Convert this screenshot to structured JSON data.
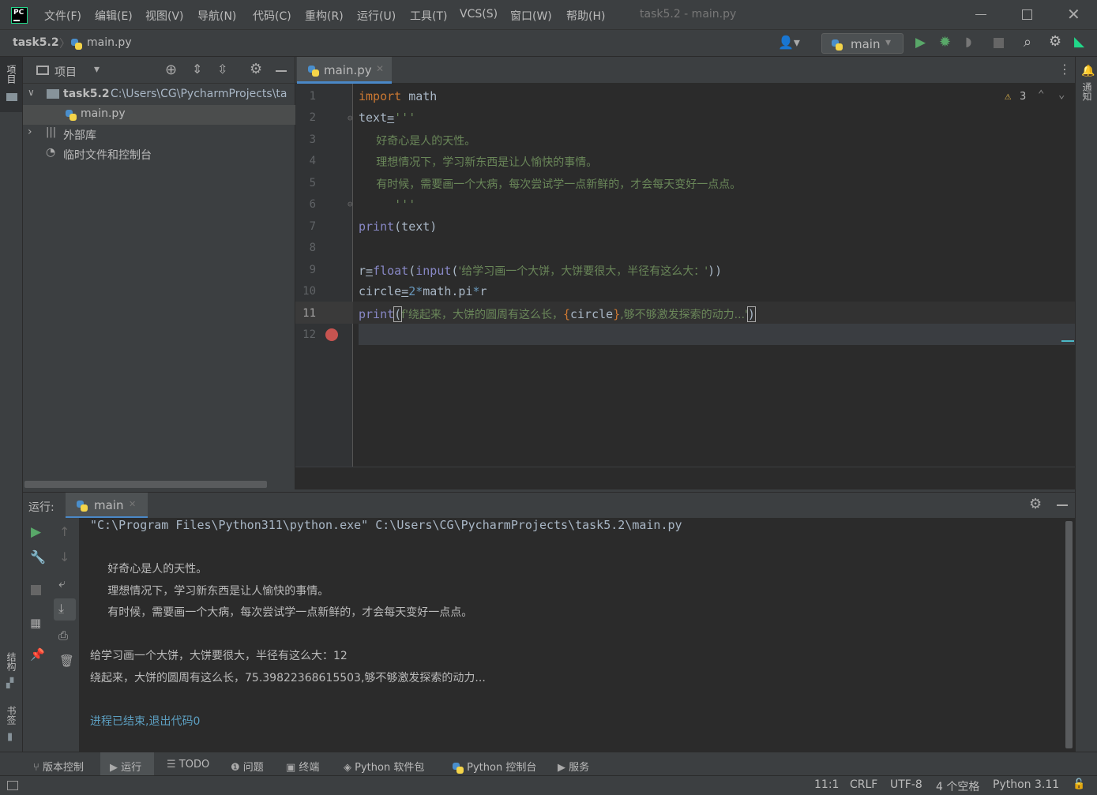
{
  "titlebar": {
    "logo": "PC",
    "menus": [
      "文件(F)",
      "编辑(E)",
      "视图(V)",
      "导航(N)",
      "代码(C)",
      "重构(R)",
      "运行(U)",
      "工具(T)",
      "VCS(S)",
      "窗口(W)",
      "帮助(H)"
    ],
    "window_title": "task5.2 - main.py"
  },
  "nav": {
    "project": "task5.2",
    "file": "main.py",
    "run_config": "main"
  },
  "leftstrip": {
    "project_tab": "项目",
    "structure_tab": "结构",
    "bookmarks_tab": "书签"
  },
  "rightstrip": {
    "notifications_tab": "通知"
  },
  "project_panel": {
    "title": "项目",
    "root_name": "task5.2",
    "root_path": "C:\\Users\\CG\\PycharmProjects\\ta",
    "file": "main.py",
    "external_libs": "外部库",
    "scratches": "临时文件和控制台"
  },
  "editor": {
    "tab": "main.py",
    "warnings": "3",
    "line_numbers": [
      "1",
      "2",
      "3",
      "4",
      "5",
      "6",
      "7",
      "8",
      "9",
      "10",
      "11",
      "12"
    ],
    "lines": {
      "l1_kw": "import",
      "l1_name": " math",
      "l2_var": "text",
      "l2_eq": "=",
      "l2_str": "'''",
      "l3": "     好奇心是人的天性。",
      "l4": "     理想情况下，学习新东西是让人愉快的事情。",
      "l5": "     有时候，需要画一个大病，每次尝试学一点新鲜的，才会每天变好一点点。",
      "l6": "     '''",
      "l7_fn": "print",
      "l7_rest": "(text)",
      "l9_var": "r",
      "l9_eq": "=",
      "l9_fn": "float",
      "l9_p1": "(",
      "l9_fn2": "input",
      "l9_p2": "(",
      "l9_str": "'给学习画一个大饼，大饼要很大，半径有这么大：'",
      "l9_end": "))",
      "l10_var": "circle",
      "l10_eq": "=",
      "l10_num": "2",
      "l10_op": "*",
      "l10_rest": "math.pi",
      "l10_op2": "*",
      "l10_r": "r",
      "l11_fn": "print",
      "l11_p": "(",
      "l11_str1": "f'绕起来，大饼的圆周有这么长，",
      "l11_b1": "{",
      "l11_var": "circle",
      "l11_b2": "}",
      "l11_str2": ",够不够激发探索的动力...'",
      "l11_end": ")"
    }
  },
  "run": {
    "label": "运行:",
    "tab": "main",
    "console": [
      "\"C:\\Program Files\\Python311\\python.exe\" C:\\Users\\CG\\PycharmProjects\\task5.2\\main.py",
      "",
      "     好奇心是人的天性。",
      "     理想情况下，学习新东西是让人愉快的事情。",
      "     有时候，需要画一个大病，每次尝试学一点新鲜的，才会每天变好一点点。",
      "",
      "给学习画一个大饼，大饼要很大，半径有这么大：12",
      "绕起来，大饼的圆周有这么长，75.39822368615503,够不够激发探索的动力...",
      "",
      "进程已结束,退出代码0"
    ]
  },
  "bottom_tools": [
    "版本控制",
    "运行",
    "TODO",
    "问题",
    "终端",
    "Python 软件包",
    "Python 控制台",
    "服务"
  ],
  "status": {
    "position": "11:1",
    "line_sep": "CRLF",
    "encoding": "UTF-8",
    "indent": "4 个空格",
    "interpreter": "Python 3.11"
  },
  "colors": {
    "keyword": "#cc7832",
    "string": "#6a8759",
    "builtin": "#8888c6",
    "number": "#6897bb",
    "breakpoint": "#c75450",
    "exit_text": "#5c9fc1"
  }
}
